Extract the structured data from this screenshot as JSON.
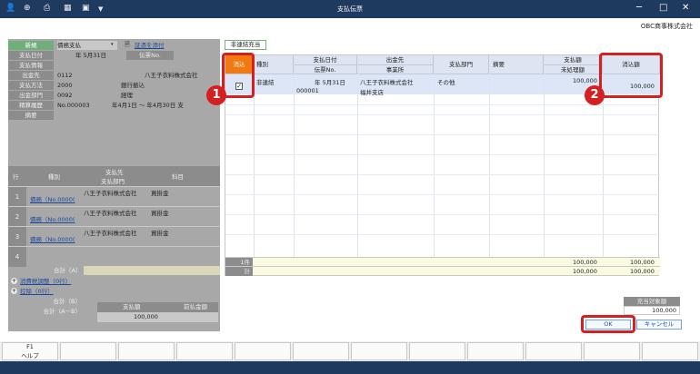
{
  "window": {
    "title": "支払伝票",
    "company": "OBC商事株式会社"
  },
  "left": {
    "fields": [
      {
        "label": "新規",
        "value": "債務支払"
      },
      {
        "label": "支払日付",
        "value": "年 5月31日"
      },
      {
        "label": "支払情報",
        "value": ""
      },
      {
        "label": "出金先",
        "value": "0112",
        "extra": "八王子衣料株式会社"
      },
      {
        "label": "支払方法",
        "value": "2000",
        "extra": "銀行振込"
      },
      {
        "label": "出金部門",
        "value": "0092",
        "extra": "経理"
      },
      {
        "label": "精算履歴",
        "value": "No.000003",
        "extra": "年4月1日 ～ 年4月30日 支"
      },
      {
        "label": "摘要",
        "value": ""
      }
    ],
    "attach_link": "証憑を添付",
    "voucher_label": "伝票No.",
    "headers": {
      "row": "行",
      "kind": "種別",
      "payee": "支払先",
      "dept": "支払部門",
      "item": "科目"
    },
    "rows": [
      {
        "num": "1",
        "kind": "債務（No.0000(",
        "payee": "八王子衣料株式会社",
        "item": "買掛金"
      },
      {
        "num": "2",
        "kind": "債務（No.0000(",
        "payee": "八王子衣料株式会社",
        "item": "買掛金"
      },
      {
        "num": "3",
        "kind": "債務（No.0000(",
        "payee": "八王子衣料株式会社",
        "item": "買掛金"
      },
      {
        "num": "4",
        "kind": "",
        "payee": "",
        "item": ""
      }
    ],
    "total_a": "合計（A）",
    "tax_adj": "消費税調整（0行）",
    "deduct": "控除（0行）",
    "total_b": "合計（B）",
    "total_ab": "合計（A－B）",
    "pay_amount_label": "支払額",
    "prepay_label": "前払金額",
    "pay_amount": "100,000"
  },
  "tab": "非連結充当",
  "grid": {
    "headers": {
      "clear": "消込",
      "kind": "種別",
      "paydate": "支払日付",
      "voucher": "伝票No.",
      "dest": "出金先",
      "office": "事業所",
      "dept": "支払部門",
      "memo": "摘要",
      "payamt": "支払額",
      "unproc": "未処理額",
      "clearamt": "消込額"
    },
    "row": {
      "checked": "✓",
      "kind": "非連結",
      "date": "年  5月31日",
      "voucher": "000001",
      "dest": "八王子衣料株式会社",
      "office": "福井支店",
      "dept": "その他",
      "payamt": "100,000",
      "clearamt": "100,000"
    },
    "count_label": "1件",
    "total_label": "計",
    "sum1_pay": "100,000",
    "sum1_clear": "100,000",
    "sum2_pay": "100,000",
    "sum2_clear": "100,000"
  },
  "target": {
    "label": "充当対象額",
    "value": "100,000"
  },
  "buttons": {
    "ok": "OK",
    "cancel": "キャンセル"
  },
  "fkeys": [
    {
      "key": "F1",
      "label": "ヘルプ"
    },
    {
      "key": "",
      "label": ""
    },
    {
      "key": "",
      "label": ""
    },
    {
      "key": "",
      "label": ""
    },
    {
      "key": "",
      "label": ""
    },
    {
      "key": "",
      "label": ""
    },
    {
      "key": "",
      "label": ""
    },
    {
      "key": "",
      "label": ""
    },
    {
      "key": "",
      "label": ""
    },
    {
      "key": "",
      "label": ""
    },
    {
      "key": "",
      "label": ""
    },
    {
      "key": "",
      "label": ""
    }
  ],
  "badges": [
    "1",
    "2"
  ]
}
